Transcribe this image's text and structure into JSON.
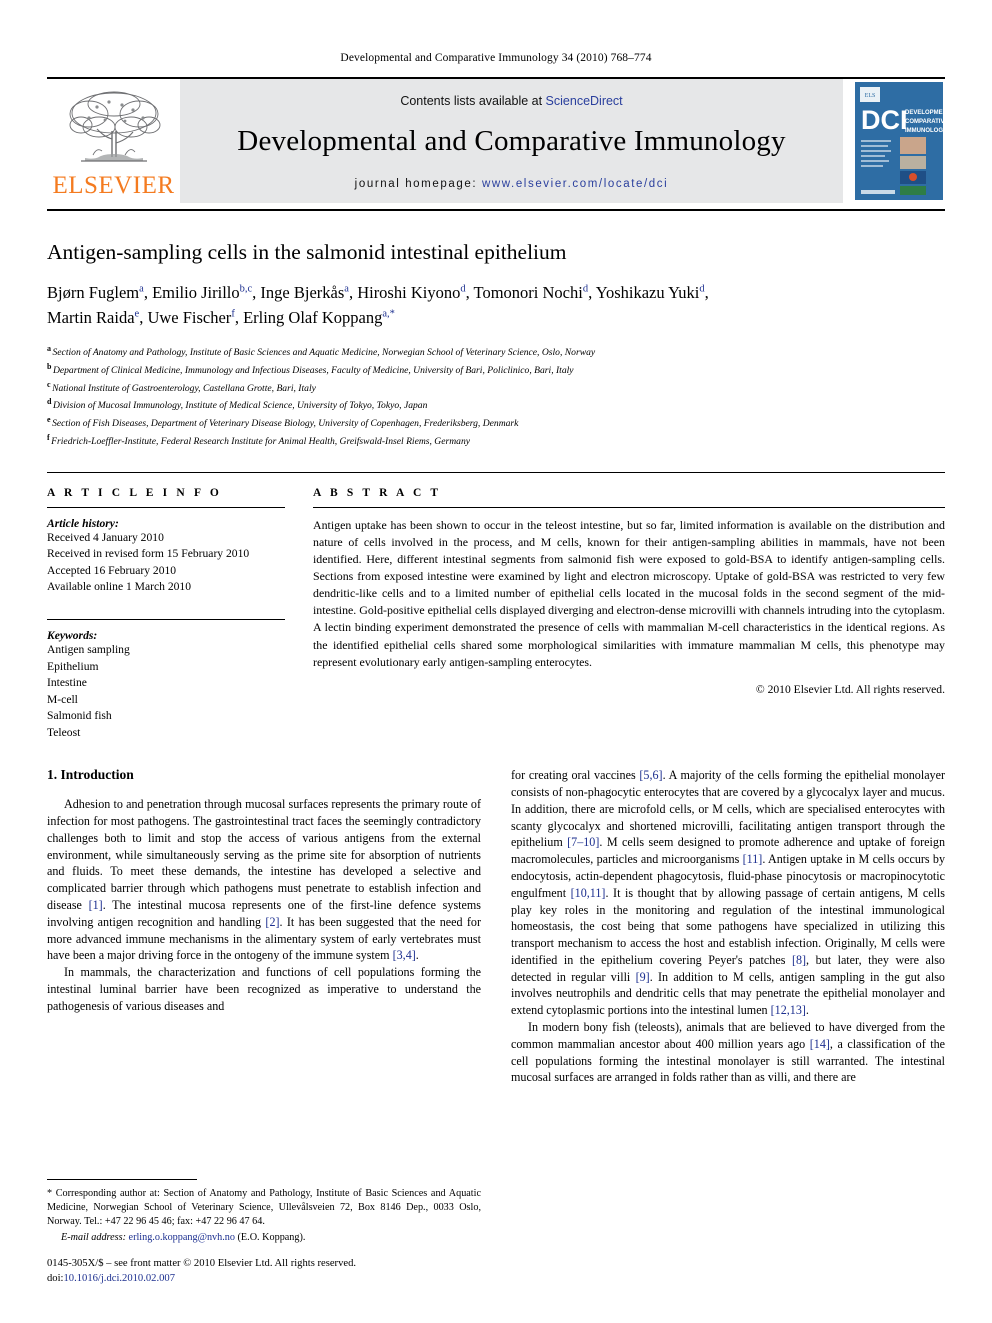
{
  "running_head": "Developmental and Comparative Immunology 34 (2010) 768–774",
  "masthead": {
    "publisher_name": "ELSEVIER",
    "contents_prefix": "Contents lists available at ",
    "sciencedirect": "ScienceDirect",
    "journal_title": "Developmental and Comparative Immunology",
    "homepage_label": "journal homepage: ",
    "homepage_url": "www.elsevier.com/locate/dci",
    "cover": {
      "acronym": "DCI",
      "title_line1": "DEVELOPMENTAL &",
      "title_line2": "COMPARATIVE",
      "title_line3": "IMMUNOLOGY",
      "background_color": "#2e6da4"
    }
  },
  "article": {
    "title": "Antigen-sampling cells in the salmonid intestinal epithelium",
    "authors_line1": "Bjørn Fuglem a, Emilio Jirillo b,c, Inge Bjerkås a, Hiroshi Kiyono d, Tomonori Nochi d, Yoshikazu Yuki d,",
    "authors_line2": "Martin Raida e, Uwe Fischer f, Erling Olaf Koppang a,*",
    "affiliations": [
      {
        "mark": "a",
        "text": "Section of Anatomy and Pathology, Institute of Basic Sciences and Aquatic Medicine, Norwegian School of Veterinary Science, Oslo, Norway"
      },
      {
        "mark": "b",
        "text": "Department of Clinical Medicine, Immunology and Infectious Diseases, Faculty of Medicine, University of Bari, Policlinico, Bari, Italy"
      },
      {
        "mark": "c",
        "text": "National Institute of Gastroenterology, Castellana Grotte, Bari, Italy"
      },
      {
        "mark": "d",
        "text": "Division of Mucosal Immunology, Institute of Medical Science, University of Tokyo, Tokyo, Japan"
      },
      {
        "mark": "e",
        "text": "Section of Fish Diseases, Department of Veterinary Disease Biology, University of Copenhagen, Frederiksberg, Denmark"
      },
      {
        "mark": "f",
        "text": "Friedrich-Loeffler-Institute, Federal Research Institute for Animal Health, Greifswald-Insel Riems, Germany"
      }
    ]
  },
  "article_info": {
    "heading": "A R T I C L E   I N F O",
    "history_label": "Article history:",
    "history": [
      "Received 4 January 2010",
      "Received in revised form 15 February 2010",
      "Accepted 16 February 2010",
      "Available online 1 March 2010"
    ],
    "keywords_label": "Keywords:",
    "keywords": [
      "Antigen sampling",
      "Epithelium",
      "Intestine",
      "M-cell",
      "Salmonid fish",
      "Teleost"
    ]
  },
  "abstract": {
    "heading": "A B S T R A C T",
    "text": "Antigen uptake has been shown to occur in the teleost intestine, but so far, limited information is available on the distribution and nature of cells involved in the process, and M cells, known for their antigen-sampling abilities in mammals, have not been identified. Here, different intestinal segments from salmonid fish were exposed to gold-BSA to identify antigen-sampling cells. Sections from exposed intestine were examined by light and electron microscopy. Uptake of gold-BSA was restricted to very few dendritic-like cells and to a limited number of epithelial cells located in the mucosal folds in the second segment of the mid-intestine. Gold-positive epithelial cells displayed diverging and electron-dense microvilli with channels intruding into the cytoplasm. A lectin binding experiment demonstrated the presence of cells with mammalian M-cell characteristics in the identical regions. As the identified epithelial cells shared some morphological similarities with immature mammalian M cells, this phenotype may represent evolutionary early antigen-sampling enterocytes.",
    "copyright": "© 2010 Elsevier Ltd. All rights reserved."
  },
  "introduction": {
    "section_title": "1. Introduction",
    "left_para1_a": "Adhesion to and penetration through mucosal surfaces represents the primary route of infection for most pathogens. The gastrointestinal tract faces the seemingly contradictory challenges both to limit and stop the access of various antigens from the external environment, while simultaneously serving as the prime site for absorption of nutrients and fluids. To meet these demands, the intestine has developed a selective and complicated barrier through which pathogens must penetrate to establish infection and disease ",
    "left_para1_r1": "[1]",
    "left_para1_b": ". The intestinal mucosa represents one of the first-line defence systems involving antigen recognition and handling ",
    "left_para1_r2": "[2]",
    "left_para1_c": ". It has been suggested that the need for more advanced immune mechanisms in the alimentary system of early vertebrates must have been a major driving force in the ontogeny of the immune system ",
    "left_para1_r3": "[3,4]",
    "left_para1_d": ".",
    "left_para2": "In mammals, the characterization and functions of cell populations forming the intestinal luminal barrier have been recognized as imperative to understand the pathogenesis of various diseases and",
    "right_para1_a": "for creating oral vaccines ",
    "right_para1_r1": "[5,6]",
    "right_para1_b": ". A majority of the cells forming the epithelial monolayer consists of non-phagocytic enterocytes that are covered by a glycocalyx layer and mucus. In addition, there are microfold cells, or M cells, which are specialised enterocytes with scanty glycocalyx and shortened microvilli, facilitating antigen transport through the epithelium ",
    "right_para1_r2": "[7–10]",
    "right_para1_c": ". M cells seem designed to promote adherence and uptake of foreign macromolecules, particles and microorganisms ",
    "right_para1_r3": "[11]",
    "right_para1_d": ". Antigen uptake in M cells occurs by endocytosis, actin-dependent phagocytosis, fluid-phase pinocytosis or macropinocytotic engulfment ",
    "right_para1_r4": "[10,11]",
    "right_para1_e": ". It is thought that by allowing passage of certain antigens, M cells play key roles in the monitoring and regulation of the intestinal immunological homeostasis, the cost being that some pathogens have specialized in utilizing this transport mechanism to access the host and establish infection. Originally, M cells were identified in the epithelium covering Peyer's patches ",
    "right_para1_r5": "[8]",
    "right_para1_f": ", but later, they were also detected in regular villi ",
    "right_para1_r6": "[9]",
    "right_para1_g": ". In addition to M cells, antigen sampling in the gut also involves neutrophils and dendritic cells that may penetrate the epithelial monolayer and extend cytoplasmic portions into the intestinal lumen ",
    "right_para1_r7": "[12,13]",
    "right_para1_h": ".",
    "right_para2_a": "In modern bony fish (teleosts), animals that are believed to have diverged from the common mammalian ancestor about 400 million years ago ",
    "right_para2_r1": "[14]",
    "right_para2_b": ", a classification of the cell populations forming the intestinal monolayer is still warranted. The intestinal mucosal surfaces are arranged in folds rather than as villi, and there are"
  },
  "footnote": {
    "corresponding": "* Corresponding author at: Section of Anatomy and Pathology, Institute of Basic Sciences and Aquatic Medicine, Norwegian School of Veterinary Science, Ullevålsveien 72, Box 8146 Dep., 0033 Oslo, Norway. Tel.: +47 22 96 45 46; fax: +47 22 96 47 64.",
    "email_label": "E-mail address: ",
    "email": "erling.o.koppang@nvh.no",
    "email_suffix": " (E.O. Koppang).",
    "issn_line": "0145-305X/$ – see front matter © 2010 Elsevier Ltd. All rights reserved.",
    "doi_label": "doi:",
    "doi_value": "10.1016/j.dci.2010.02.007"
  }
}
